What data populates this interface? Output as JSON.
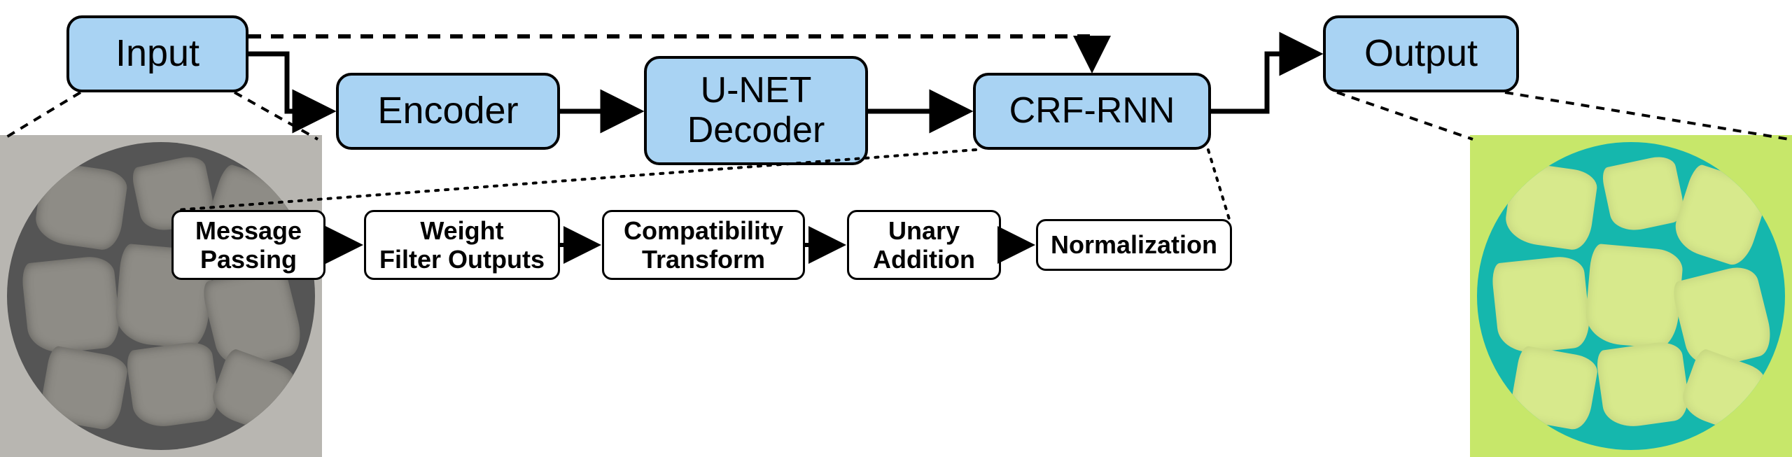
{
  "pipeline": {
    "input_label": "Input",
    "encoder_label": "Encoder",
    "decoder_label": "U-NET\nDecoder",
    "crf_label": "CRF-RNN",
    "output_label": "Output"
  },
  "crf_steps": {
    "step1": "Message\nPassing",
    "step2": "Weight\nFilter Outputs",
    "step3": "Compatibility\nTransform",
    "step4": "Unary\nAddition",
    "step5": "Normalization"
  },
  "colors": {
    "node_fill": "#a9d3f3",
    "border": "#000000",
    "output_bg": "#c7e76a",
    "output_circle": "#15b7ad",
    "output_shard": "#d7e98c"
  }
}
